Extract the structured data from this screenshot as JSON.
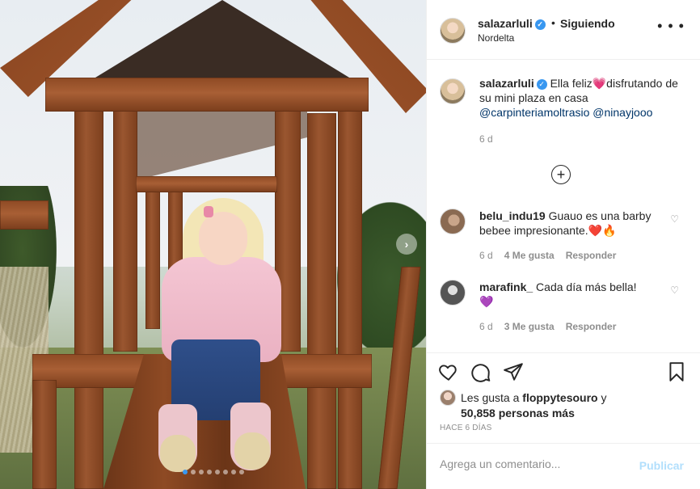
{
  "post": {
    "username": "salazarluli",
    "follow_status": "Siguiendo",
    "separator": "•",
    "location": "Nordelta",
    "caption": {
      "username": "salazarluli",
      "text_before": "Ella feliz",
      "emoji": "💗",
      "text_after": "disfrutando de su mini plaza en casa",
      "mention_1": "@carpinteriamoltrasio",
      "mention_2": "@ninayjooo",
      "time": "6 d"
    },
    "comments": [
      {
        "username": "belu_indu19",
        "text": "Guauo es una barby bebee impresionante.",
        "emoji": "❤️🔥",
        "time": "6 d",
        "likes": "4 Me gusta",
        "reply": "Responder"
      },
      {
        "username": "marafink_",
        "text": "Cada día más bella!",
        "emoji": "💜",
        "time": "6 d",
        "likes": "3 Me gusta",
        "reply": "Responder"
      }
    ],
    "likes_prefix": "Les gusta a",
    "likes_user": "floppytesouro",
    "likes_conj": "y",
    "likes_count": "50,858 personas más",
    "posted_ago": "HACE 6 DÍAS",
    "add_comment_placeholder": "Agrega un comentario...",
    "publish_label": "Publicar",
    "carousel_total": 8,
    "carousel_active_index": 0
  },
  "icons": {
    "more": "more-options-icon",
    "like": "heart-outline-icon",
    "comment": "comment-bubble-icon",
    "share": "paper-plane-icon",
    "save": "bookmark-icon",
    "next": "chevron-right-icon",
    "load_more": "plus-circle-icon",
    "comment_like": "small-heart-icon"
  },
  "colors": {
    "accent": "#3897f0",
    "publish_disabled": "#b2dffc",
    "meta": "#8e8e8e"
  }
}
